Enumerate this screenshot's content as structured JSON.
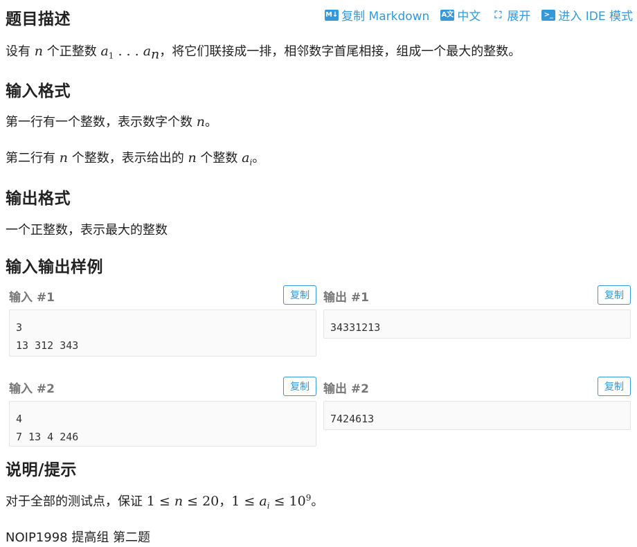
{
  "toolbar": {
    "copy_markdown": "复制 Markdown",
    "chinese": "中文",
    "expand": "展开",
    "ide_mode": "进入 IDE 模式"
  },
  "description": {
    "heading": "题目描述",
    "text_prefix": "设有 ",
    "text_mid1": " 个正整数 ",
    "text_suffix": "，将它们联接成一排，相邻数字首尾相接，组成一个最大的整数。"
  },
  "input_format": {
    "heading": "输入格式",
    "line1_prefix": "第一行有一个整数，表示数字个数 ",
    "line1_suffix": "。",
    "line2_prefix": "第二行有 ",
    "line2_mid": " 个整数，表示给出的 ",
    "line2_mid2": " 个整数 ",
    "line2_suffix": "。"
  },
  "output_format": {
    "heading": "输出格式",
    "text": "一个正整数，表示最大的整数"
  },
  "samples": {
    "heading": "输入输出样例",
    "copy_label": "复制",
    "items": [
      {
        "input_title": "输入 #1",
        "input": "3\n13 312 343",
        "output_title": "输出 #1",
        "output": "34331213"
      },
      {
        "input_title": "输入 #2",
        "input": "4\n7 13 4 246",
        "output_title": "输出 #2",
        "output": "7424613"
      }
    ]
  },
  "notes": {
    "heading": "说明/提示",
    "text_prefix": "对于全部的测试点，保证 ",
    "sep": "，",
    "text_suffix": "。",
    "source": "NOIP1998 提高组 第二题"
  }
}
